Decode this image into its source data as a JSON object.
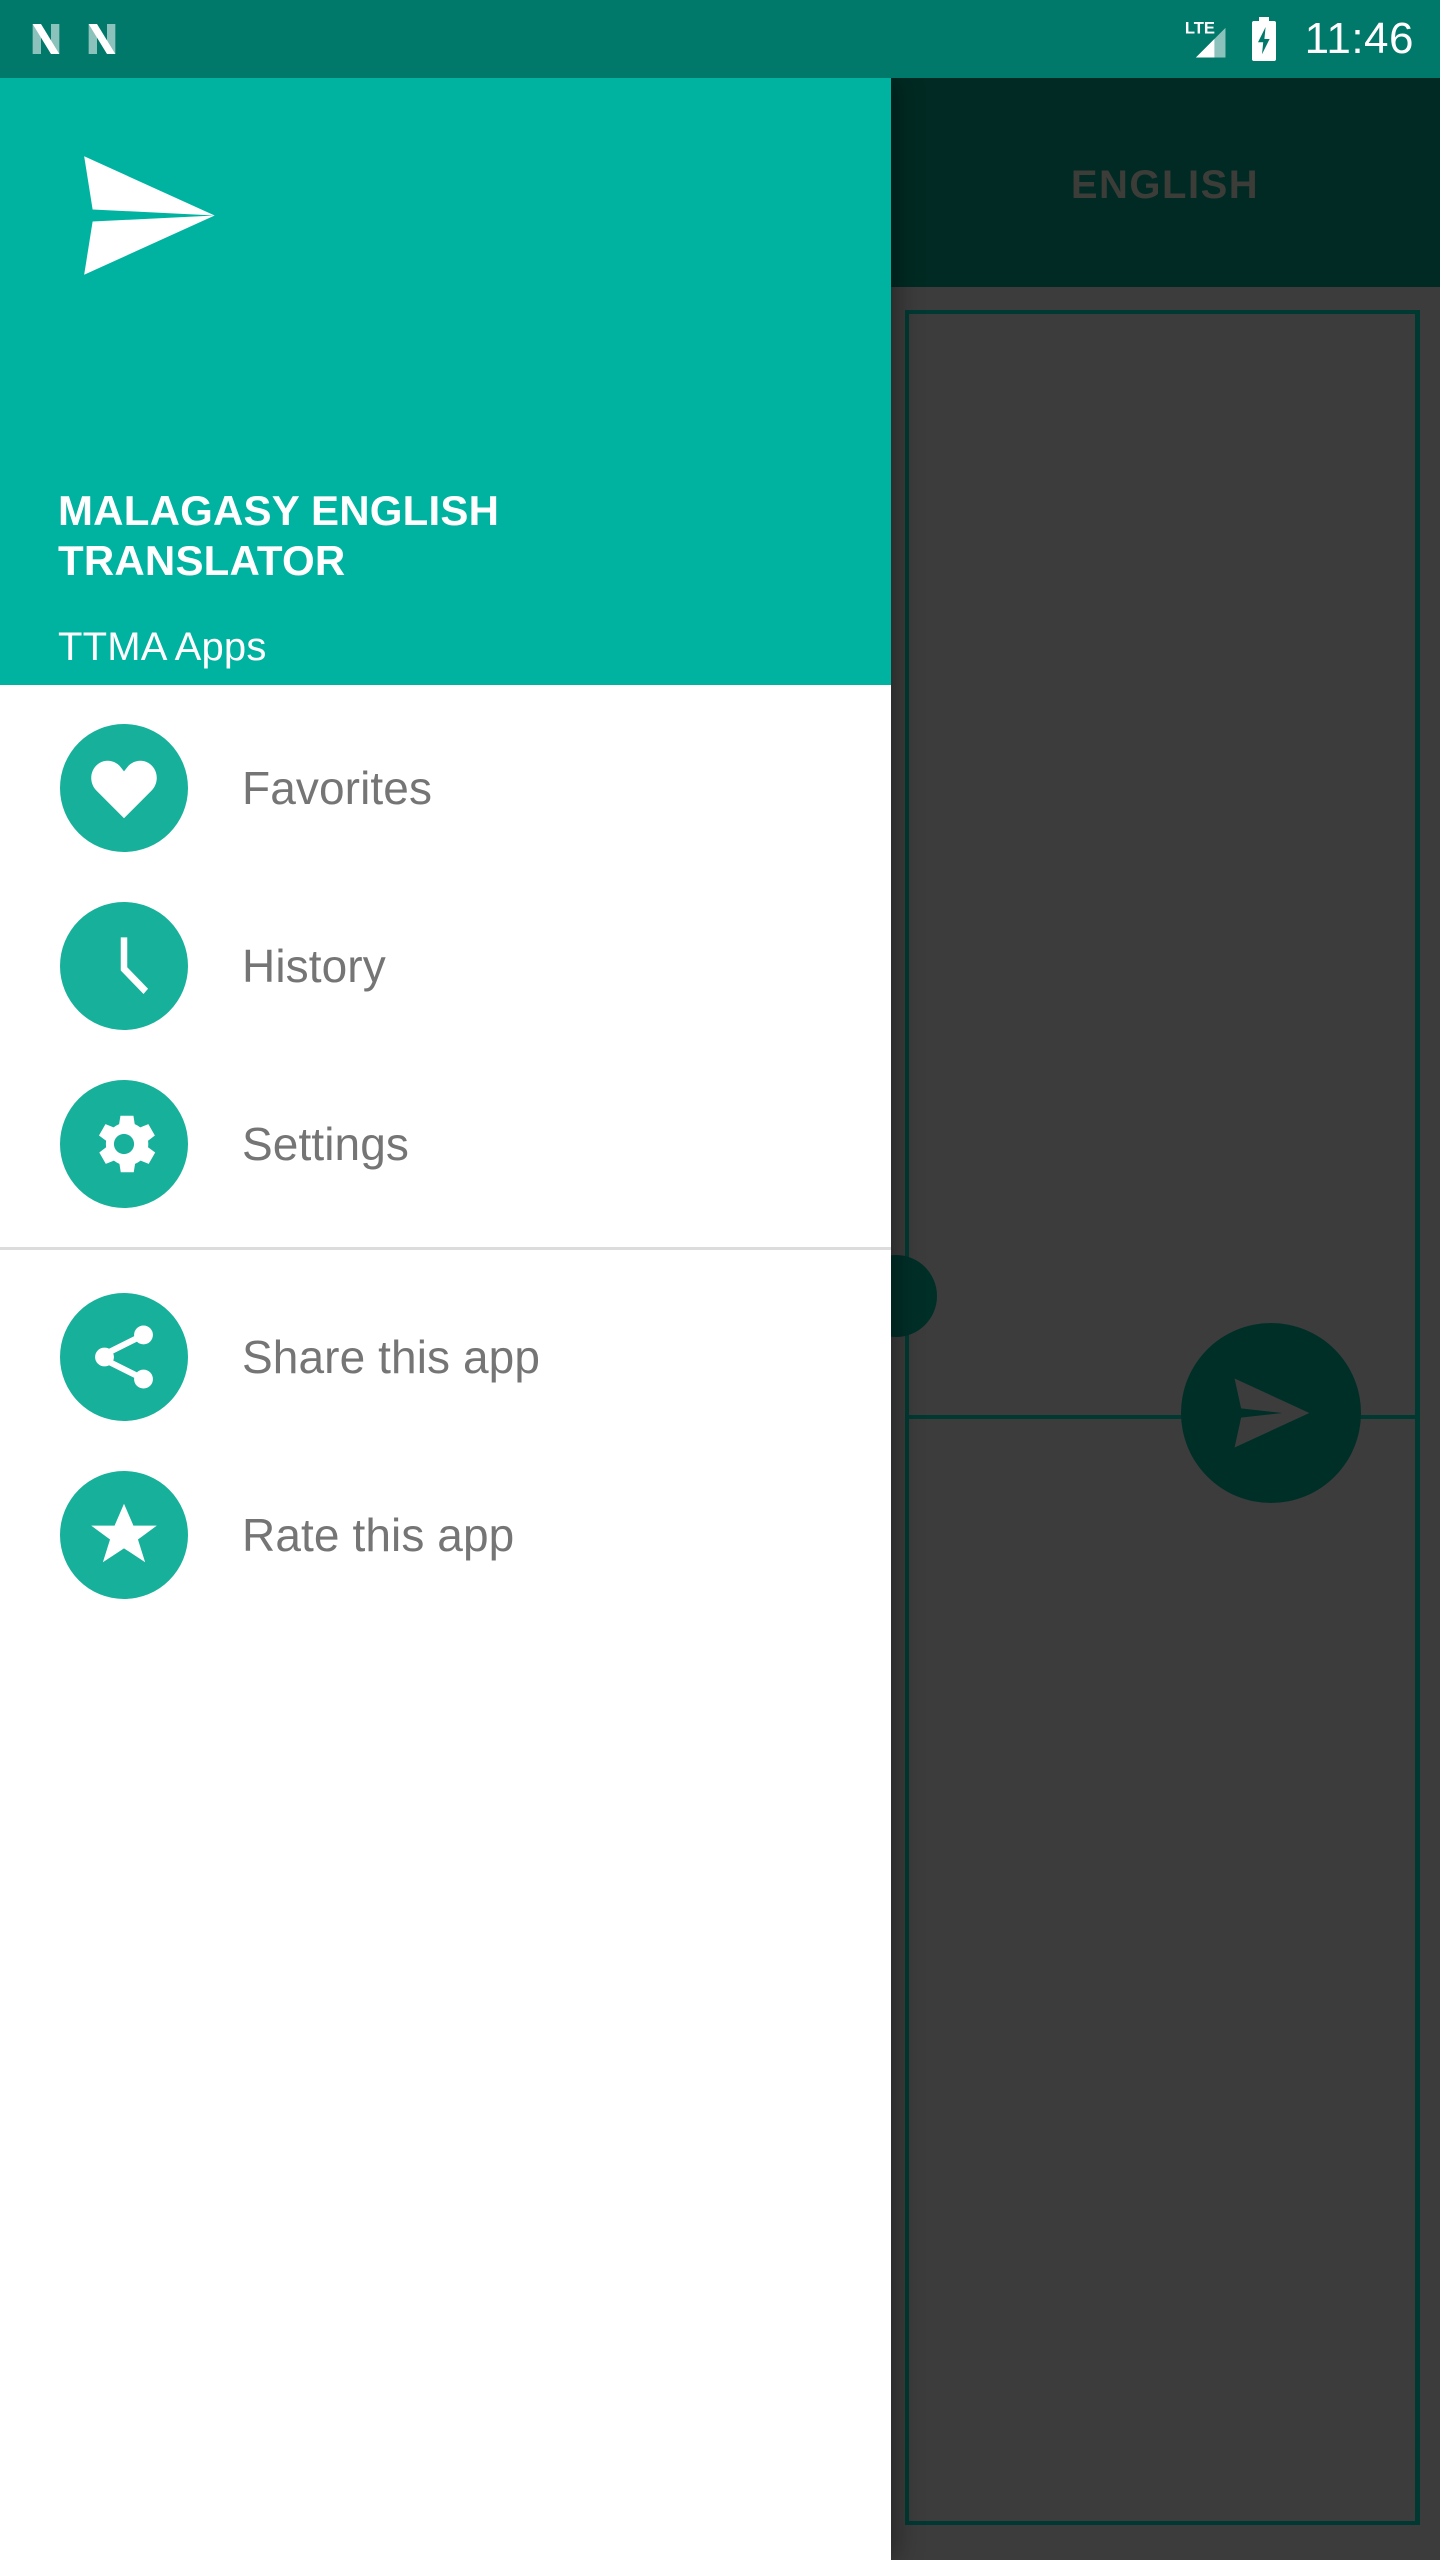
{
  "status_bar": {
    "notification_icons": [
      "n-logo-icon",
      "n-logo-icon"
    ],
    "network_type": "LTE",
    "signal_icon": "signal-bars-icon",
    "battery_icon": "battery-charging-icon",
    "time": "11:46",
    "background_color": "#00796b",
    "foreground_color": "#ffffff"
  },
  "drawer": {
    "header": {
      "logo_icon": "paper-plane-send-icon",
      "title": "MALAGASY ENGLISH TRANSLATOR",
      "subtitle": "TTMA Apps",
      "background_color": "#00b3a1",
      "text_color": "#ffffff"
    },
    "primary_items": [
      {
        "id": "favorites",
        "label": "Favorites",
        "icon": "heart-icon"
      },
      {
        "id": "history",
        "label": "History",
        "icon": "clock-icon"
      },
      {
        "id": "settings",
        "label": "Settings",
        "icon": "gear-icon"
      }
    ],
    "secondary_items": [
      {
        "id": "share-this-app",
        "label": "Share this app",
        "icon": "share-icon"
      },
      {
        "id": "rate-this-app",
        "label": "Rate this app",
        "icon": "star-icon"
      }
    ],
    "icon_circle_color": "#17b09a",
    "label_color": "#757575",
    "background_color": "#ffffff"
  },
  "background_app": {
    "appbar": {
      "tab_label": "ENGLISH",
      "background_color": "#004d40",
      "tab_label_color": "#6d6d66"
    },
    "fab": {
      "icon": "send-icon",
      "color": "#00564a"
    },
    "mic_button": {
      "icon": "mic-button",
      "color": "#00564a"
    },
    "scrim_color": "rgba(0,0,0,0.45)",
    "card_border_color": "#00695c"
  }
}
